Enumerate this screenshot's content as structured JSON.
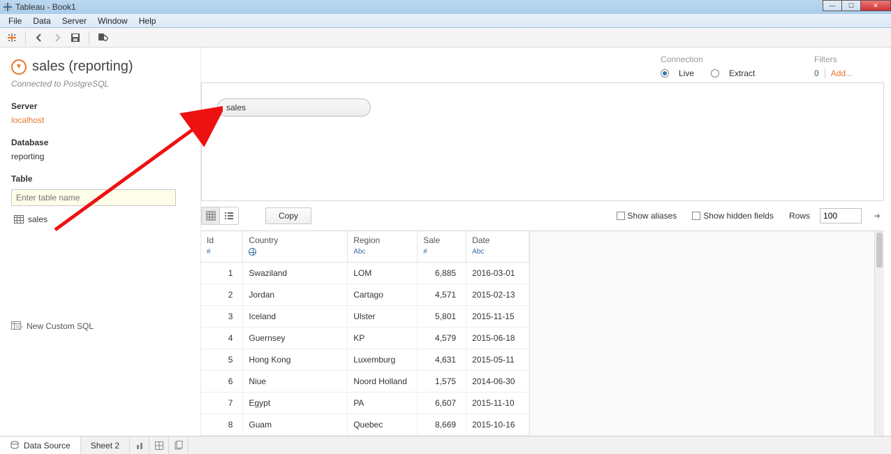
{
  "window": {
    "title": "Tableau - Book1"
  },
  "menu": {
    "items": [
      "File",
      "Data",
      "Server",
      "Window",
      "Help"
    ]
  },
  "datasource": {
    "title": "sales (reporting)",
    "subtitle": "Connected to PostgreSQL"
  },
  "server": {
    "heading": "Server",
    "value": "localhost"
  },
  "database": {
    "heading": "Database",
    "value": "reporting"
  },
  "table": {
    "heading": "Table",
    "search_placeholder": "Enter table name",
    "items": [
      "sales"
    ],
    "custom_sql_label": "New Custom SQL"
  },
  "connection": {
    "label": "Connection",
    "live": "Live",
    "extract": "Extract",
    "selected": "live"
  },
  "filters": {
    "label": "Filters",
    "count": "0",
    "add": "Add..."
  },
  "canvas": {
    "pill_label": "sales"
  },
  "grid_toolbar": {
    "copy": "Copy",
    "show_aliases": "Show aliases",
    "show_hidden": "Show hidden fields",
    "rows_label": "Rows",
    "rows_value": "100"
  },
  "columns": [
    {
      "name": "Id",
      "type": "#"
    },
    {
      "name": "Country",
      "type": "globe"
    },
    {
      "name": "Region",
      "type": "Abc"
    },
    {
      "name": "Sale",
      "type": "#"
    },
    {
      "name": "Date",
      "type": "Abc"
    }
  ],
  "rows": [
    {
      "id": "1",
      "country": "Swaziland",
      "region": "LOM",
      "sale": "6,885",
      "date": "2016-03-01"
    },
    {
      "id": "2",
      "country": "Jordan",
      "region": "Cartago",
      "sale": "4,571",
      "date": "2015-02-13"
    },
    {
      "id": "3",
      "country": "Iceland",
      "region": "Ulster",
      "sale": "5,801",
      "date": "2015-11-15"
    },
    {
      "id": "4",
      "country": "Guernsey",
      "region": "KP",
      "sale": "4,579",
      "date": "2015-06-18"
    },
    {
      "id": "5",
      "country": "Hong Kong",
      "region": "Luxemburg",
      "sale": "4,631",
      "date": "2015-05-11"
    },
    {
      "id": "6",
      "country": "Niue",
      "region": "Noord Holland",
      "sale": "1,575",
      "date": "2014-06-30"
    },
    {
      "id": "7",
      "country": "Egypt",
      "region": "PA",
      "sale": "6,607",
      "date": "2015-11-10"
    },
    {
      "id": "8",
      "country": "Guam",
      "region": "Quebec",
      "sale": "8,669",
      "date": "2015-10-16"
    }
  ],
  "bottom_tabs": {
    "data_source": "Data Source",
    "sheet": "Sheet 2"
  }
}
